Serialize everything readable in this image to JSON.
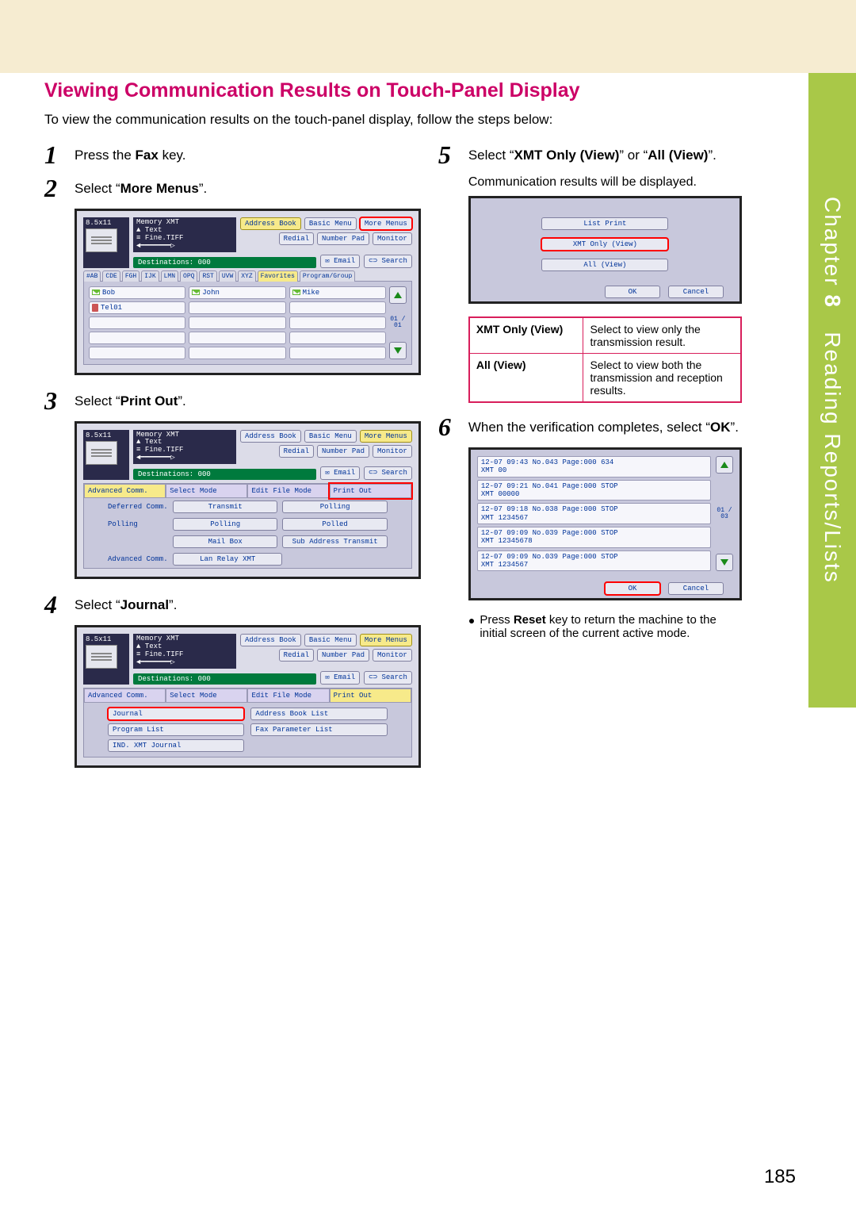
{
  "side_tab": {
    "chapter_word": "Chapter",
    "chapter_num": "8",
    "title": "Reading Reports/Lists"
  },
  "section_title": "Viewing Communication Results on Touch-Panel Display",
  "intro": "To view the communication results on the touch-panel display, follow the steps below:",
  "steps": {
    "s1": {
      "num": "1",
      "prefix": "Press the ",
      "bold": "Fax",
      "suffix": " key."
    },
    "s2": {
      "num": "2",
      "prefix": "Select “",
      "bold": "More Menus",
      "suffix": "”."
    },
    "s3": {
      "num": "3",
      "prefix": "Select “",
      "bold": "Print Out",
      "suffix": "”."
    },
    "s4": {
      "num": "4",
      "prefix": "Select “",
      "bold": "Journal",
      "suffix": "”."
    },
    "s5": {
      "num": "5",
      "prefix": "Select “",
      "bold1": "XMT Only (View)",
      "mid": "” or “",
      "bold2": "All (View)",
      "suffix": "”."
    },
    "s5_sub": "Communication results will be displayed.",
    "s6": {
      "num": "6",
      "prefix": "When the verification completes, select “",
      "bold": "OK",
      "suffix": "”."
    }
  },
  "panel_header": {
    "paper": "8.5x11",
    "mem": "Memory XMT",
    "orig": "Text",
    "res": "Fine.TIFF",
    "dest": "Destinations: 000"
  },
  "head_btns": {
    "addr": "Address Book",
    "basic": "Basic Menu",
    "more": "More Menus",
    "redial": "Redial",
    "numpad": "Number Pad",
    "monitor": "Monitor",
    "email": "Email",
    "search": "Search"
  },
  "tabs": [
    "#AB",
    "CDE",
    "FGH",
    "IJK",
    "LMN",
    "OPQ",
    "RST",
    "UVW",
    "XYZ",
    "Favorites",
    "Program/Group"
  ],
  "addr_entries": {
    "bob": "Bob",
    "john": "John",
    "mike": "Mike",
    "tel01": "Tel01"
  },
  "scroll": {
    "count": "01 / 01"
  },
  "func_head": {
    "adv": "Advanced Comm.",
    "mode": "Select Mode",
    "edit": "Edit File Mode",
    "print": "Print Out"
  },
  "func_rows": {
    "r1": {
      "label": "Deferred Comm.",
      "b1": "Transmit",
      "b2": "Polling"
    },
    "r2": {
      "label": "Polling",
      "b1": "Polling",
      "b2": "Polled"
    },
    "r3": {
      "label": "",
      "b1": "Mail Box",
      "b2": "Sub Address Transmit"
    },
    "r4": {
      "label": "Advanced Comm.",
      "b1": "Lan Relay XMT",
      "b2": ""
    }
  },
  "list_btns": {
    "journal": "Journal",
    "program": "Program List",
    "ind": "IND. XMT Journal",
    "abook": "Address Book List",
    "fparam": "Fax Parameter List"
  },
  "view_btns": {
    "list_print": "List Print",
    "xmt_only": "XMT Only (View)",
    "all_view": "All (View)"
  },
  "okcancel": {
    "ok": "OK",
    "cancel": "Cancel"
  },
  "opt_table": {
    "k1": "XMT Only (View)",
    "v1": "Select to view only the transmission result.",
    "k2": "All (View)",
    "v2": "Select to view both the transmission and reception results."
  },
  "log": {
    "scroll": "01 / 03",
    "rows": [
      {
        "l1": "12-07 09:43    No.043    Page:000   634",
        "l2": "XMT                00"
      },
      {
        "l1": "12-07 09:21    No.041    Page:000   STOP",
        "l2": "XMT               00000"
      },
      {
        "l1": "12-07 09:18    No.038    Page:000   STOP",
        "l2": "XMT              1234567"
      },
      {
        "l1": "12-07 09:09    No.039    Page:000   STOP",
        "l2": "XMT             12345678"
      },
      {
        "l1": "12-07 09:09    No.039    Page:000   STOP",
        "l2": "XMT              1234567"
      }
    ]
  },
  "note": {
    "prefix": "Press ",
    "bold": "Reset",
    "suffix": " key to return the machine to the initial screen of the current active mode."
  },
  "page_number": "185"
}
